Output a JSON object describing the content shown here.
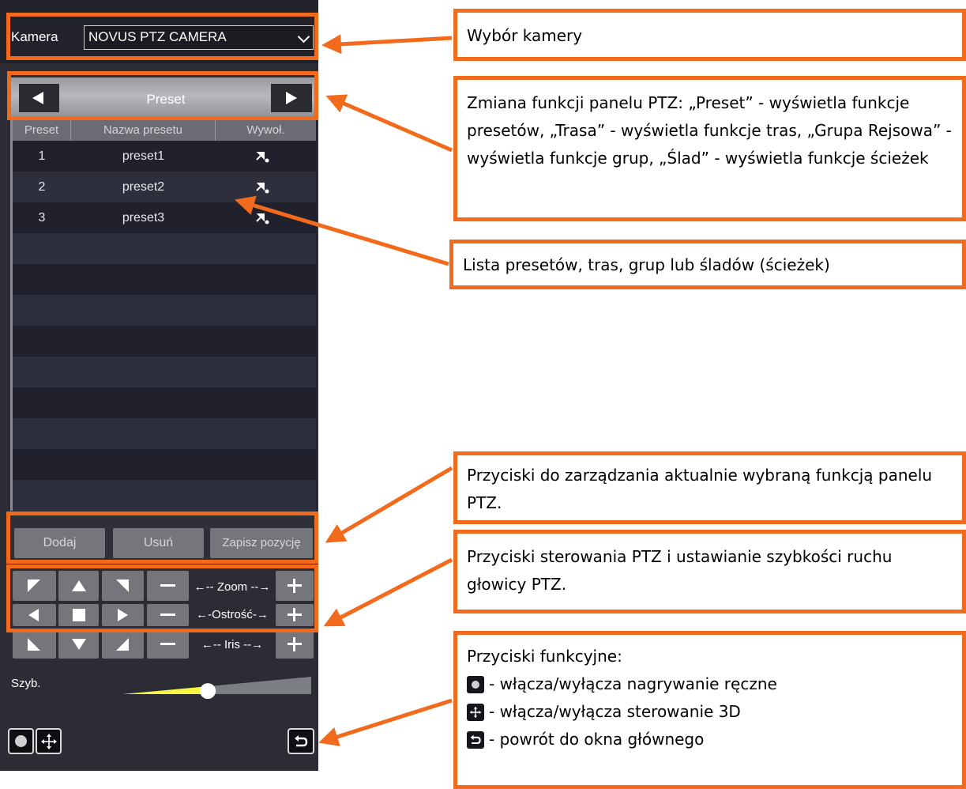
{
  "camera": {
    "label": "Kamera",
    "selected": "NOVUS PTZ CAMERA"
  },
  "mode_bar": {
    "title": "Preset"
  },
  "table": {
    "headers": [
      "Preset",
      "Nazwa presetu",
      "Wywoł."
    ],
    "rows": [
      {
        "num": "1",
        "name": "preset1"
      },
      {
        "num": "2",
        "name": "preset2"
      },
      {
        "num": "3",
        "name": "preset3"
      }
    ]
  },
  "actions": {
    "add": "Dodaj",
    "remove": "Usuń",
    "save": "Zapisz pozycję"
  },
  "ptz": {
    "zoom": "←-- Zoom --→",
    "focus": "←-Ostrość-→",
    "iris": "←--  Iris  --→",
    "speed_label": "Szyb.",
    "speed_value": 0.45
  },
  "callouts": {
    "camera": "Wybór kamery",
    "mode": "Zmiana funkcji panelu PTZ: „Preset” - wyświetla funkcje presetów, „Trasa” - wyświetla funkcje tras, „Grupa Rejsowa” - wyświetla funkcje grup, „Ślad” - wyświetla funkcje ścieżek",
    "list": "Lista presetów, tras, grup lub śladów (ścieżek)",
    "manage": "Przyciski do zarządzania aktualnie wybraną funkcją panelu PTZ.",
    "control": "Przyciski sterowania PTZ i ustawianie szybkości ruchu głowicy PTZ.",
    "functions_title": "Przyciski funkcyjne:",
    "func_record": "- włącza/wyłącza nagrywanie ręczne",
    "func_3d": "- włącza/wyłącza sterowanie 3D",
    "func_back": "- powrót do okna głównego"
  },
  "colors": {
    "accent": "#f26b1d",
    "speed_fill": "#f5f542",
    "panel_bg": "#2b2c34"
  },
  "icons": {
    "record": "record-icon",
    "move_3d": "move-3d-icon",
    "back": "back-icon",
    "call_preset": "call-preset-icon"
  }
}
